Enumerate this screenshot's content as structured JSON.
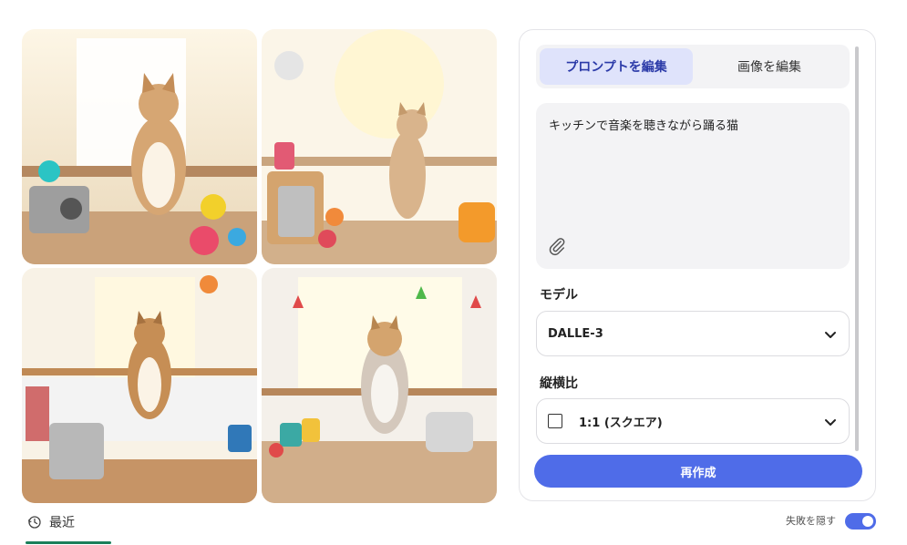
{
  "tabs": {
    "edit_prompt": "プロンプトを編集",
    "edit_image": "画像を編集"
  },
  "prompt": {
    "text": "キッチンで音楽を聴きながら踊る猫"
  },
  "model": {
    "label": "モデル",
    "value": "DALLE-3"
  },
  "aspect": {
    "label": "縦横比",
    "value": "1:1 (スクエア)"
  },
  "regenerate_label": "再作成",
  "recent_label": "最近",
  "hide_failures_label": "失敗を隠す",
  "hide_failures_enabled": true,
  "colors": {
    "accent": "#4f6ce8",
    "tab_active_bg": "#dfe3fb",
    "tab_active_text": "#2b3aa8",
    "recent_underline": "#1a7f5a"
  },
  "icons": {
    "paperclip": "paperclip-icon",
    "chevron": "chevron-down-icon",
    "history": "history-icon"
  }
}
